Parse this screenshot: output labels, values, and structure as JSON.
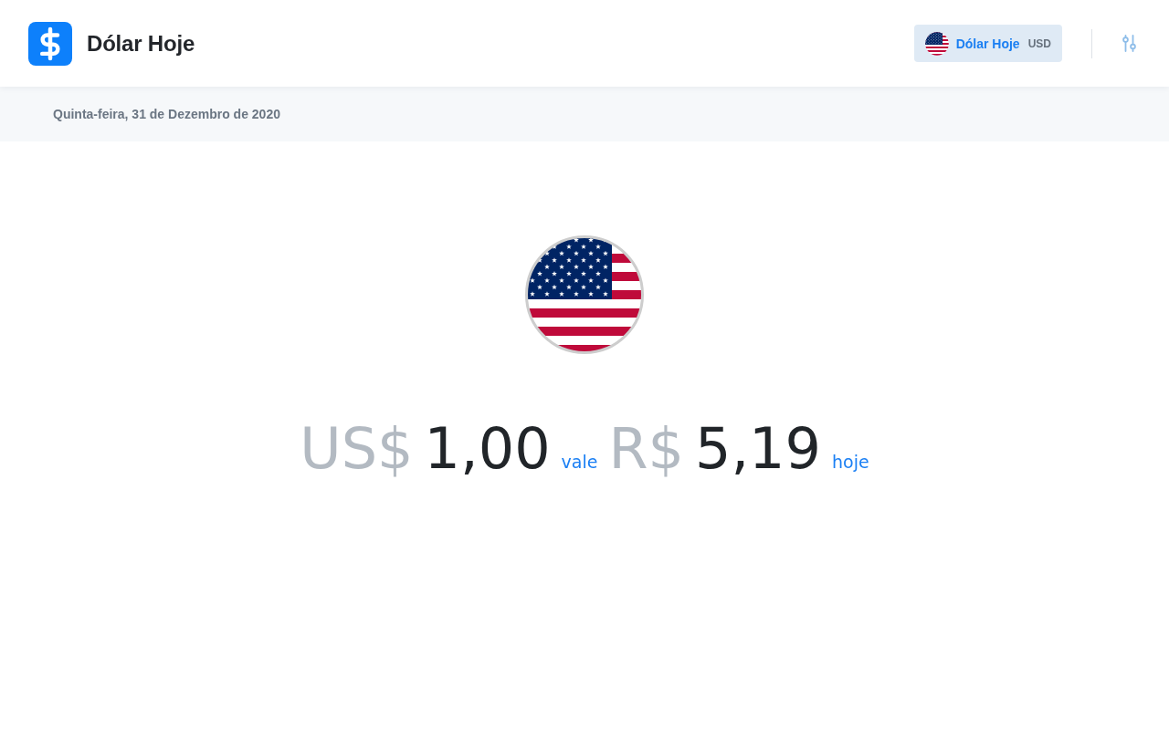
{
  "header": {
    "title": "Dólar Hoje",
    "currency_button": {
      "label": "Dólar Hoje",
      "code": "USD"
    }
  },
  "date_bar": {
    "date": "Quinta-feira, 31 de Dezembro de 2020"
  },
  "quote": {
    "from_symbol": "US$",
    "from_amount": "1,00",
    "connector": "vale",
    "to_symbol": "R$",
    "to_amount": "5,19",
    "suffix": "hoje"
  }
}
